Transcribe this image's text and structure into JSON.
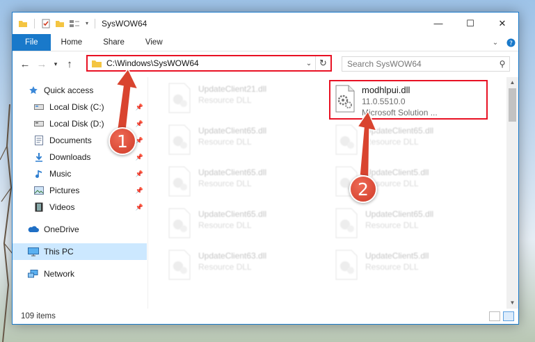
{
  "window": {
    "title": "SysWOW64",
    "controls": {
      "minimize": "—",
      "maximize": "☐",
      "close": "✕"
    }
  },
  "ribbon": {
    "tabs": [
      "File",
      "Home",
      "Share",
      "View"
    ]
  },
  "navbar": {
    "address_path": "C:\\Windows\\SysWOW64",
    "search_placeholder": "Search SysWOW64"
  },
  "sidebar": {
    "items": [
      {
        "label": "Quick access",
        "icon": "star-icon"
      },
      {
        "label": "Local Disk (C:)",
        "icon": "drive-icon",
        "pinned": true
      },
      {
        "label": "Local Disk (D:)",
        "icon": "drive-icon",
        "pinned": true
      },
      {
        "label": "Documents",
        "icon": "documents-icon",
        "pinned": true
      },
      {
        "label": "Downloads",
        "icon": "download-icon",
        "pinned": true
      },
      {
        "label": "Music",
        "icon": "music-icon",
        "pinned": true
      },
      {
        "label": "Pictures",
        "icon": "pictures-icon",
        "pinned": true
      },
      {
        "label": "Videos",
        "icon": "videos-icon",
        "pinned": true
      },
      {
        "label": "OneDrive",
        "icon": "cloud-icon"
      },
      {
        "label": "This PC",
        "icon": "computer-icon",
        "selected": true
      },
      {
        "label": "Network",
        "icon": "network-icon"
      }
    ]
  },
  "files": {
    "highlighted": {
      "name": "modhlpui.dll",
      "version": "11.0.5510.0",
      "description": "Microsoft Solution ..."
    },
    "left_column": [
      {
        "name": "UpdateClient21.dll",
        "type": "Resource DLL"
      },
      {
        "name": "UpdateClient65.dll",
        "type": "Resource DLL"
      },
      {
        "name": "UpdateClient65.dll",
        "type": "Resource DLL"
      },
      {
        "name": "UpdateClient65.dll",
        "type": "Resource DLL"
      },
      {
        "name": "UpdateClient63.dll",
        "type": "Resource DLL"
      }
    ],
    "right_column": [
      {
        "name": "UpdateClient65.dll",
        "type": "Resource DLL"
      },
      {
        "name": "UpdateClient5.dll",
        "type": "Resource DLL"
      },
      {
        "name": "UpdateClient65.dll",
        "type": "Resource DLL"
      },
      {
        "name": "UpdateClient5.dll",
        "type": "Resource DLL"
      }
    ]
  },
  "status": {
    "item_count": "109 items"
  },
  "callouts": {
    "one": "1",
    "two": "2"
  },
  "colors": {
    "accent": "#1979ca",
    "highlight": "#e81123",
    "callout": "#d9442f",
    "selected": "#cce8ff"
  }
}
